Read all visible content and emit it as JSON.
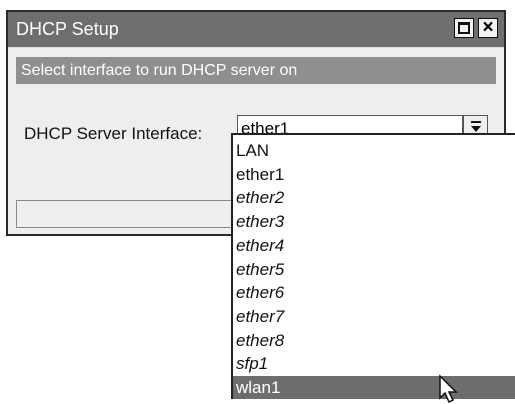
{
  "window": {
    "title": "DHCP Setup"
  },
  "subheader": "Select interface to run DHCP server on",
  "field": {
    "label": "DHCP Server Interface:",
    "value": "ether1"
  },
  "dropdown": {
    "options": [
      {
        "label": "LAN",
        "italic": false,
        "selected": false
      },
      {
        "label": "ether1",
        "italic": false,
        "selected": false
      },
      {
        "label": "ether2",
        "italic": true,
        "selected": false
      },
      {
        "label": "ether3",
        "italic": true,
        "selected": false
      },
      {
        "label": "ether4",
        "italic": true,
        "selected": false
      },
      {
        "label": "ether5",
        "italic": true,
        "selected": false
      },
      {
        "label": "ether6",
        "italic": true,
        "selected": false
      },
      {
        "label": "ether7",
        "italic": true,
        "selected": false
      },
      {
        "label": "ether8",
        "italic": true,
        "selected": false
      },
      {
        "label": "sfp1",
        "italic": true,
        "selected": false
      },
      {
        "label": "wlan1",
        "italic": false,
        "selected": true
      }
    ]
  },
  "icons": {
    "maximize": "maximize-icon",
    "close": "close-icon",
    "dropdown_arrow": "dropdown-arrow-icon",
    "cursor": "mouse-pointer-icon"
  }
}
